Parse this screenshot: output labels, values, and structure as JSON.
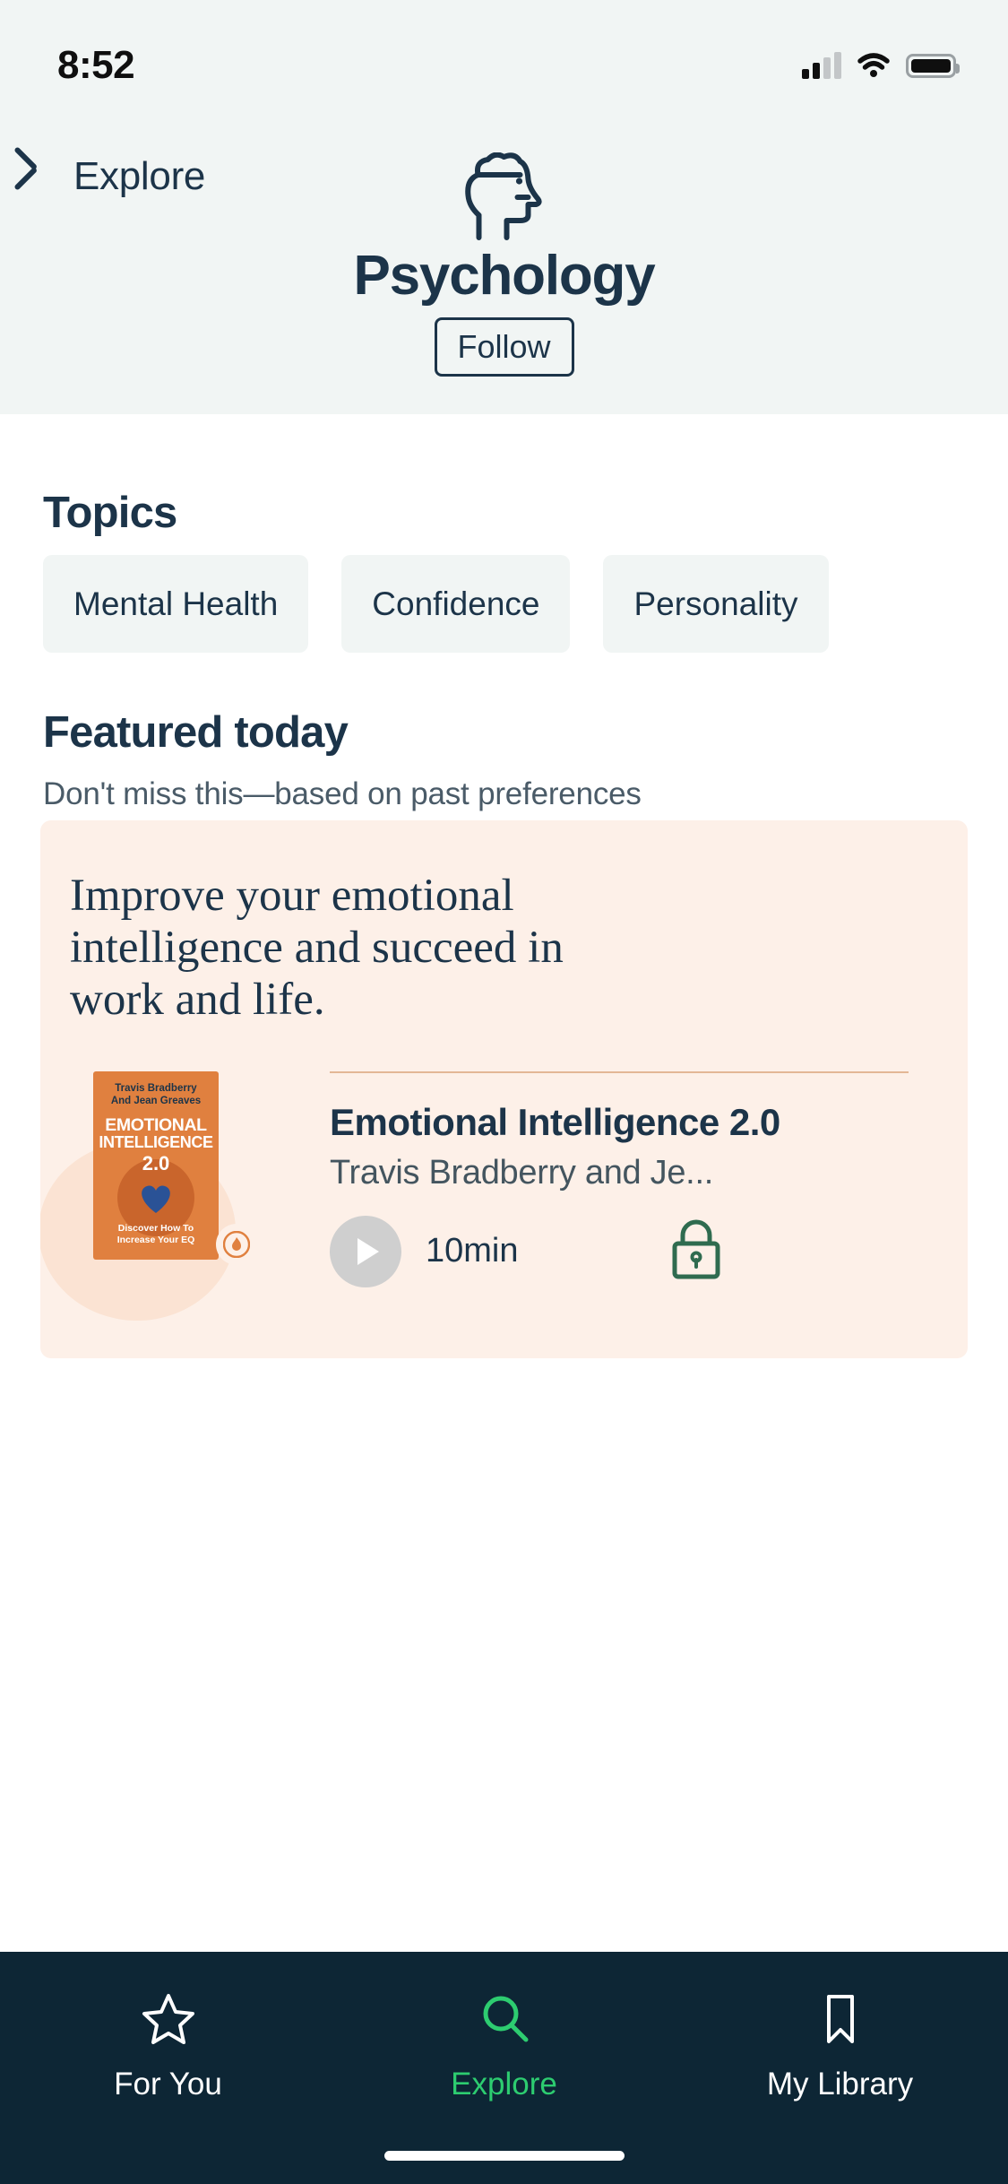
{
  "status_bar": {
    "time": "8:52",
    "signal_icon": "cellular-signal-icon",
    "wifi_icon": "wifi-icon",
    "battery_icon": "battery-icon"
  },
  "header": {
    "back_label": "Explore",
    "back_icon": "chevron-left-icon",
    "category_icon": "head-profile-icon",
    "title": "Psychology",
    "follow_label": "Follow",
    "background_color": "#f1f5f4",
    "text_color": "#1c3449"
  },
  "topics": {
    "title": "Topics",
    "chips": [
      {
        "label": "Mental Health"
      },
      {
        "label": "Confidence"
      },
      {
        "label": "Personality"
      }
    ]
  },
  "featured": {
    "title": "Featured today",
    "subtitle": "Don't miss this—based on past preferences",
    "card": {
      "headline": "Improve your emotional intelligence and succeed in work and life.",
      "background_color": "#fdf0e8",
      "book": {
        "cover": {
          "authors_line1": "Travis Bradberry",
          "authors_line2": "And Jean Greaves",
          "title_line1": "EMOTIONAL",
          "title_line2": "INTELLIGENCE",
          "version": "2.0",
          "footer_line1": "Discover How To",
          "footer_line2": "Increase Your EQ",
          "accent_color": "#e0803f",
          "badge_icon": "blinkist-flame-icon"
        },
        "title": "Emotional Intelligence 2.0",
        "author": "Travis Bradberry and Je...",
        "duration": "10min",
        "play_icon": "play-icon",
        "lock_icon": "lock-icon"
      }
    }
  },
  "tabbar": {
    "background_color": "#0d2635",
    "active_color": "#2dcc70",
    "items": [
      {
        "label": "For You",
        "icon": "star-icon",
        "active": false
      },
      {
        "label": "Explore",
        "icon": "search-icon",
        "active": true
      },
      {
        "label": "My Library",
        "icon": "bookmark-icon",
        "active": false
      }
    ]
  }
}
